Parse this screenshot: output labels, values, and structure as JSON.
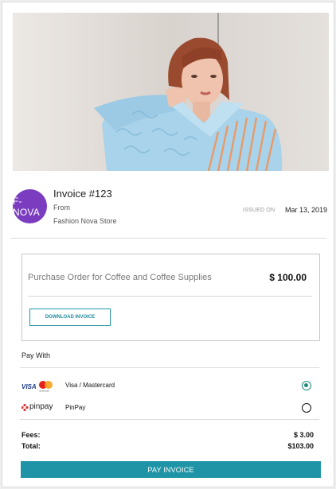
{
  "colors": {
    "accent": "#1f94a6",
    "logo_bg": "#7b3cc0",
    "radio_selected": "#1f8a7c"
  },
  "hero": {
    "image": "model-in-striped-blue-shirt-photo"
  },
  "invoice": {
    "logo_text": "F-NOVA",
    "title": "Invoice #123",
    "from_label": "From",
    "store": "Fashion Nova Store",
    "issued_label": "ISSUED ON",
    "issued_date": "Mar 13, 2019"
  },
  "order": {
    "description": "Purchase Order for Coffee and Coffee Supplies",
    "amount": "$ 100.00",
    "download_label": "DOWNLOAD INVOICE"
  },
  "payment": {
    "title": "Pay With",
    "methods": [
      {
        "label": "Visa / Mastercard",
        "icon": "visa-mastercard-icon",
        "selected": true
      },
      {
        "label": "PinPay",
        "icon": "pinpay-icon",
        "brand_text": "pinpay",
        "selected": false
      }
    ]
  },
  "totals": {
    "fees_label": "Fees:",
    "fees_value": "$ 3.00",
    "total_label": "Total:",
    "total_value": "$103.00"
  },
  "cta": {
    "label": "PAY INVOICE"
  }
}
